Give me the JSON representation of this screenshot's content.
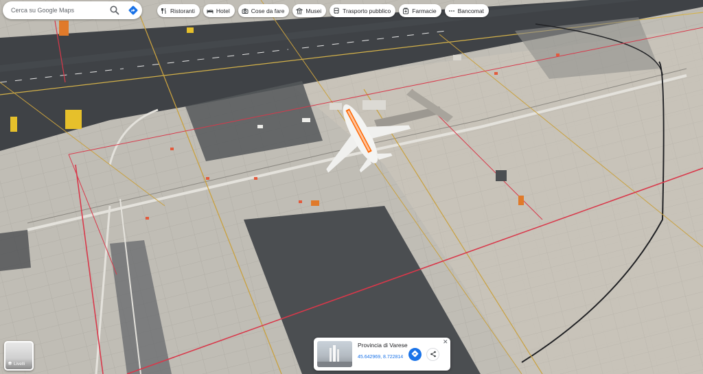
{
  "search": {
    "placeholder": "Cerca su Google Maps"
  },
  "chips": [
    {
      "label": "Ristoranti",
      "icon": "fork-knife-icon"
    },
    {
      "label": "Hotel",
      "icon": "bed-icon"
    },
    {
      "label": "Cose da fare",
      "icon": "camera-icon"
    },
    {
      "label": "Musei",
      "icon": "museum-icon"
    },
    {
      "label": "Trasporto pubblico",
      "icon": "bus-icon"
    },
    {
      "label": "Farmacie",
      "icon": "pharmacy-icon"
    },
    {
      "label": "Bancomat",
      "icon": "more-dots-icon"
    }
  ],
  "layers": {
    "label": "Livelli",
    "icon": "layers-icon"
  },
  "place_card": {
    "title": "Provincia di Varese",
    "coordinates": "45.642969, 8.722814"
  },
  "airplane_livery": "easyJet.com",
  "colors": {
    "accent": "#1a73e8",
    "orange_livery": "#ff6600",
    "apron": "#bdbab2",
    "runway": "#3f4246"
  }
}
